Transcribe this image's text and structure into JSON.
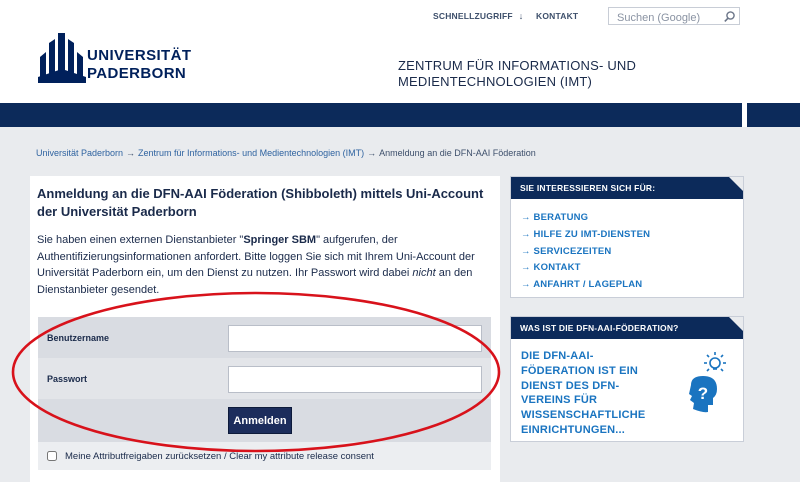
{
  "header": {
    "quick_access": "SCHNELLZUGRIFF",
    "quick_arrow": "↓",
    "contact": "KONTAKT",
    "search_placeholder": "Suchen (Google)",
    "university_line1": "UNIVERSITÄT",
    "university_line2": "PADERBORN",
    "institute_line1": "ZENTRUM FÜR INFORMATIONS- UND",
    "institute_line2": "MEDIENTECHNOLOGIEN (IMT)"
  },
  "breadcrumb": {
    "items": [
      "Universität Paderborn",
      "Zentrum für Informations- und Medientechnologien (IMT)",
      "Anmeldung an die DFN-AAI Föderation"
    ],
    "separator": "→"
  },
  "main": {
    "title": "Anmeldung an die DFN-AAI Föderation (Shibboleth) mittels Uni-Account der Universität Paderborn",
    "intro_part1": "Sie haben einen externen Dienstanbieter \"",
    "provider": "Springer SBM",
    "intro_part2": "\" aufgerufen, der Authentifizierungsinformationen anfordert. Bitte loggen Sie sich mit Ihrem Uni-Account der Universität Paderborn ein, um den Dienst zu nutzen. Ihr Passwort wird dabei ",
    "intro_emph": "nicht",
    "intro_part3": " an den Dienstanbieter gesendet.",
    "username_label": "Benutzername",
    "password_label": "Passwort",
    "login_button": "Anmelden",
    "consent_label": "Meine Attributfreigaben zurücksetzen / Clear my attribute release consent"
  },
  "sidebar": {
    "interests_title": "SIE INTERESSIEREN SICH FÜR:",
    "interest_links": [
      "BERATUNG",
      "HILFE ZU IMT-DIENSTEN",
      "SERVICEZEITEN",
      "KONTAKT",
      "ANFAHRT / LAGEPLAN"
    ],
    "link_arrow": "→",
    "dfn_title": "WAS IST DIE DFN-AAI-FÖDERATION?",
    "dfn_text": "DIE DFN-AAI-FÖDERATION IST EIN DIENST DES DFN-VEREINS FÜR WISSENSCHAFTLICHE EINRICHTUNGEN..."
  },
  "colors": {
    "navy": "#0c2a5a",
    "link_blue": "#1a74c0",
    "annotation_red": "#d8121b",
    "page_gray": "#e9ebee"
  }
}
